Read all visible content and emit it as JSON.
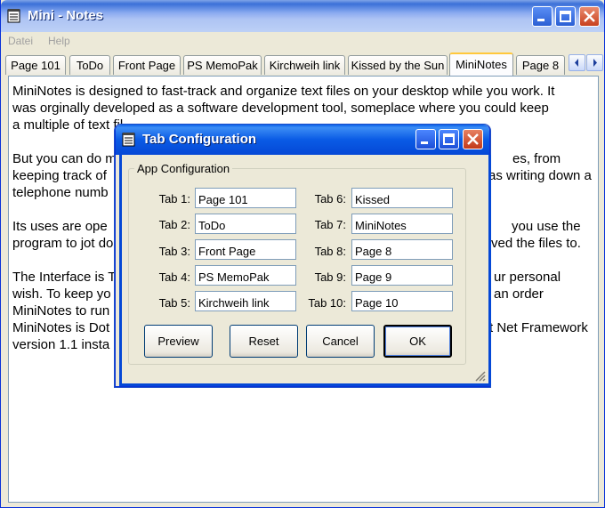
{
  "window": {
    "title": "Mini - Notes",
    "menu": [
      "Datei",
      "Help"
    ]
  },
  "tabs": [
    "Page 101",
    "ToDo",
    "Front Page",
    "PS MemoPak",
    "Kirchweih link",
    "Kissed by the Sun",
    "MiniNotes",
    "Page 8"
  ],
  "active_tab": "MiniNotes",
  "content": {
    "p1_l1": "MiniNotes is designed to fast-track and organize text files on your desktop while you work. It",
    "p1_l2": "was orginally developed as a software development tool, someplace where you could keep",
    "p1_l3": "a multiple of text fil",
    "p2_l1": "But you can do m",
    "p2_l1_end": "es, from",
    "p2_l2": "keeping track of",
    "p2_l2_end": "as writing down a",
    "p2_l3": "telephone numb",
    "p3_l1": "Its uses are ope",
    "p3_l1_end": "you use the",
    "p3_l2": "program to jot do",
    "p3_l2_end": "ved the files to.",
    "p4_l1": "The Interface is T",
    "p4_l1_end": "ur personal",
    "p4_l2": "wish. To keep yo",
    "p4_l2_end": "an order",
    "p4_l3": "MiniNotes to run",
    "p4_l4": "MiniNotes is Dot",
    "p4_l4_end": "t Net Framework",
    "p4_l5": "version 1.1 insta"
  },
  "dialog": {
    "title": "Tab Configuration",
    "group_label": "App Configuration",
    "left_fields": [
      {
        "label": "Tab 1:",
        "value": "Page 101"
      },
      {
        "label": "Tab 2:",
        "value": "ToDo"
      },
      {
        "label": "Tab 3:",
        "value": "Front Page"
      },
      {
        "label": "Tab 4:",
        "value": "PS MemoPak"
      },
      {
        "label": "Tab 5:",
        "value": "Kirchweih link"
      }
    ],
    "right_fields": [
      {
        "label": "Tab 6:",
        "value": "Kissed"
      },
      {
        "label": "Tab 7:",
        "value": "MiniNotes"
      },
      {
        "label": "Tab 8:",
        "value": "Page 8"
      },
      {
        "label": "Tab 9:",
        "value": "Page 9"
      },
      {
        "label": "Tab 10:",
        "value": "Page 10"
      }
    ],
    "buttons": {
      "preview": "Preview",
      "reset": "Reset",
      "cancel": "Cancel",
      "ok": "OK"
    }
  },
  "icons": [
    "notepad-icon",
    "minimize-icon",
    "maximize-icon",
    "close-icon",
    "arrow-left-icon",
    "arrow-right-icon",
    "resize-grip-icon"
  ],
  "colors": {
    "titlebar_active": "#0548d6",
    "tab_highlight": "#ffc83c"
  }
}
